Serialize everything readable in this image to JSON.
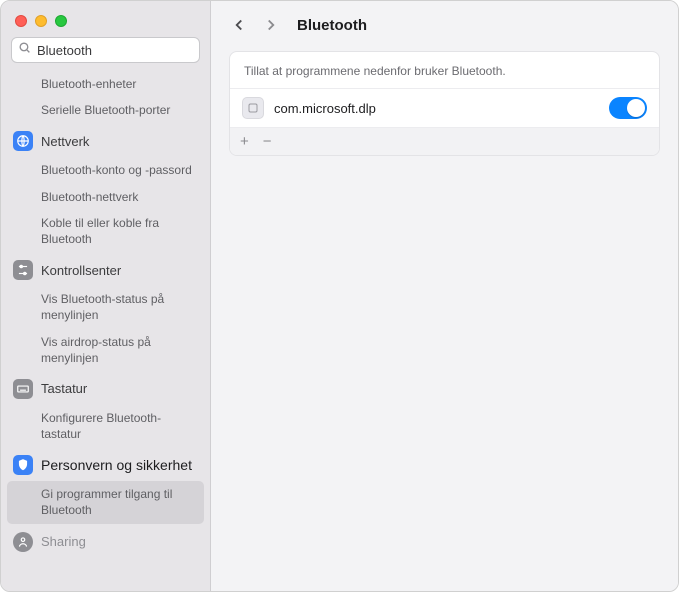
{
  "search": {
    "value": "Bluetooth"
  },
  "sidebar": {
    "top_items": [
      "Bluetooth-enheter",
      "Serielle Bluetooth-porter"
    ],
    "network": {
      "title": "Nettverk",
      "items": [
        "Bluetooth-konto og -passord",
        "Bluetooth-nettverk",
        "Koble til eller koble fra Bluetooth"
      ]
    },
    "control_center": {
      "title": "Kontrollsenter",
      "items": [
        "Vis Bluetooth-status på menylinjen",
        "Vis airdrop-status på menylinjen"
      ]
    },
    "keyboard": {
      "title": "Tastatur",
      "items": [
        "Konfigurere Bluetooth-tastatur"
      ]
    },
    "privacy": {
      "title": "Personvern og sikkerhet",
      "items": [
        "Gi programmer tilgang til Bluetooth"
      ]
    },
    "sharing": {
      "title": "Sharing"
    }
  },
  "content": {
    "title": "Bluetooth",
    "description": "Tillat at programmene nedenfor bruker Bluetooth.",
    "apps": [
      {
        "name": "com.microsoft.dlp",
        "enabled": true
      }
    ],
    "footer": {
      "add": "+",
      "remove": "−"
    }
  }
}
